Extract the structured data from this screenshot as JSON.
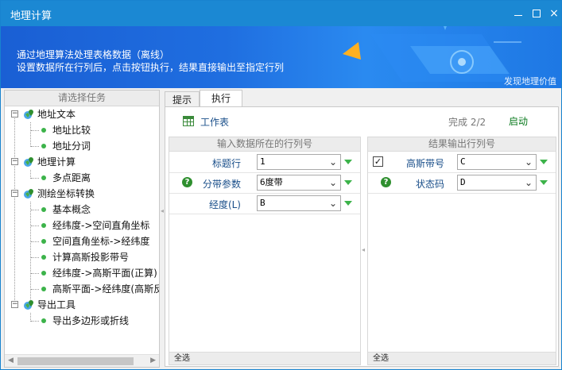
{
  "window": {
    "title": "地理计算",
    "controls": {
      "minimize": "minimize",
      "maximize": "maximize",
      "close": "×"
    }
  },
  "banner": {
    "line1": "通过地理算法处理表格数据（离线）",
    "line2": "设置数据所在行列后，点击按钮执行，结果直接输出至指定行列",
    "brand": "发现地理价值"
  },
  "task_panel": {
    "header": "请选择任务",
    "groups": [
      {
        "label": "地址文本",
        "items": [
          "地址比较",
          "地址分词"
        ]
      },
      {
        "label": "地理计算",
        "items": [
          "多点距离"
        ]
      },
      {
        "label": "测绘坐标转换",
        "items": [
          "基本概念",
          "经纬度->空间直角坐标",
          "空间直角坐标->经纬度",
          "计算高斯投影带号",
          "经纬度->高斯平面(正算)",
          "高斯平面->经纬度(高斯反"
        ]
      },
      {
        "label": "导出工具",
        "items": [
          "导出多边形或折线"
        ]
      }
    ]
  },
  "tabs": [
    {
      "label": "提示",
      "active": false
    },
    {
      "label": "执行",
      "active": true
    }
  ],
  "toolbar": {
    "worksheet": "工作表",
    "progress": "完成 2/2",
    "start": "启动"
  },
  "input_panel": {
    "header": "输入数据所在的行列号",
    "rows": [
      {
        "label": "标题行",
        "value": "1",
        "help": false
      },
      {
        "label": "分带参数",
        "value": "6度带",
        "help": true
      },
      {
        "label": "经度(L)",
        "value": "B",
        "help": false
      }
    ],
    "select_all": "全选"
  },
  "output_panel": {
    "header": "结果输出行列号",
    "rows": [
      {
        "label": "高斯带号",
        "value": "C",
        "checked": true,
        "help": false
      },
      {
        "label": "状态码",
        "value": "D",
        "checked": false,
        "help": true
      }
    ],
    "select_all": "全选"
  },
  "colors": {
    "titlebar": "#1b88d3",
    "banner": "#1f6ee0",
    "label_blue": "#1a4f8a",
    "start_green": "#0a7a1e",
    "bullet_green": "#3cb34a"
  },
  "icons": {
    "worksheet": "table-icon",
    "help": "question-circle-icon",
    "group": "globe-pin-icon",
    "item": "green-dot-icon",
    "dropdown": "chevron-down-icon",
    "fill_down": "green-triangle-down-icon"
  }
}
